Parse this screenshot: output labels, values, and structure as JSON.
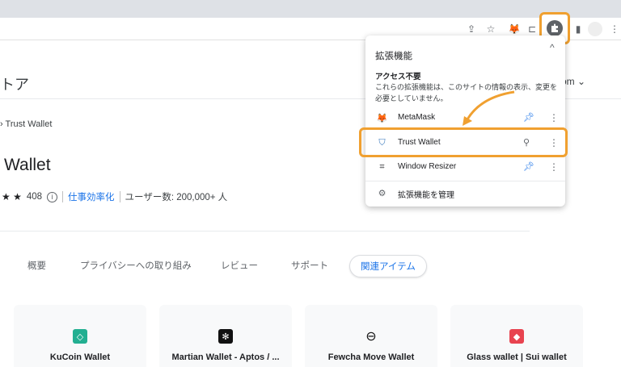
{
  "browser": {
    "extensions_button_icon": "puzzle-icon",
    "toolbar_icons": [
      "share-icon",
      "star-icon",
      "metamask-icon",
      "sidebar-icon"
    ]
  },
  "store": {
    "title_fragment": "トア",
    "account_fragment": "om ⌄",
    "breadcrumb": "› Trust Wallet",
    "extension_name": "Wallet",
    "stars": "★ ★",
    "rating_count": "408",
    "info_icon": "i",
    "category": "仕事効率化",
    "users": "ユーザー数: 200,000+ 人",
    "tabs": [
      {
        "label": "概要",
        "active": false
      },
      {
        "label": "プライバシーへの取り組み",
        "active": false
      },
      {
        "label": "レビュー",
        "active": false
      },
      {
        "label": "サポート",
        "active": false
      },
      {
        "label": "関連アイテム",
        "active": true
      }
    ],
    "related": [
      {
        "name": "KuCoin Wallet",
        "color": "#23af91",
        "glyph": "◇"
      },
      {
        "name": "Martian Wallet - Aptos / ...",
        "color": "#111111",
        "glyph": "✻"
      },
      {
        "name": "Fewcha Move Wallet",
        "color": "#ffffff",
        "glyph": "⊖"
      },
      {
        "name": "Glass wallet | Sui wallet",
        "color": "#e8434f",
        "glyph": "◆"
      }
    ]
  },
  "popup": {
    "title": "拡張機能",
    "close": "^",
    "section_title": "アクセス不要",
    "section_desc": "これらの拡張機能は、このサイトの情報の表示、変更を必要としていません。",
    "items": [
      {
        "label": "MetaMask",
        "icon": "metamask-fox-icon",
        "glyph": "🦊",
        "pinned": true
      },
      {
        "label": "Trust Wallet",
        "icon": "trust-wallet-shield-icon",
        "glyph": "⛉",
        "pinned": false
      },
      {
        "label": "Window Resizer",
        "icon": "window-resizer-icon",
        "glyph": "⌗",
        "pinned": true
      }
    ],
    "manage_label": "拡張機能を管理",
    "manage_icon": "gear-icon"
  },
  "colors": {
    "accent_orange": "#f0a030",
    "link_blue": "#1a73e8",
    "pin_blue": "#1a73e8"
  }
}
